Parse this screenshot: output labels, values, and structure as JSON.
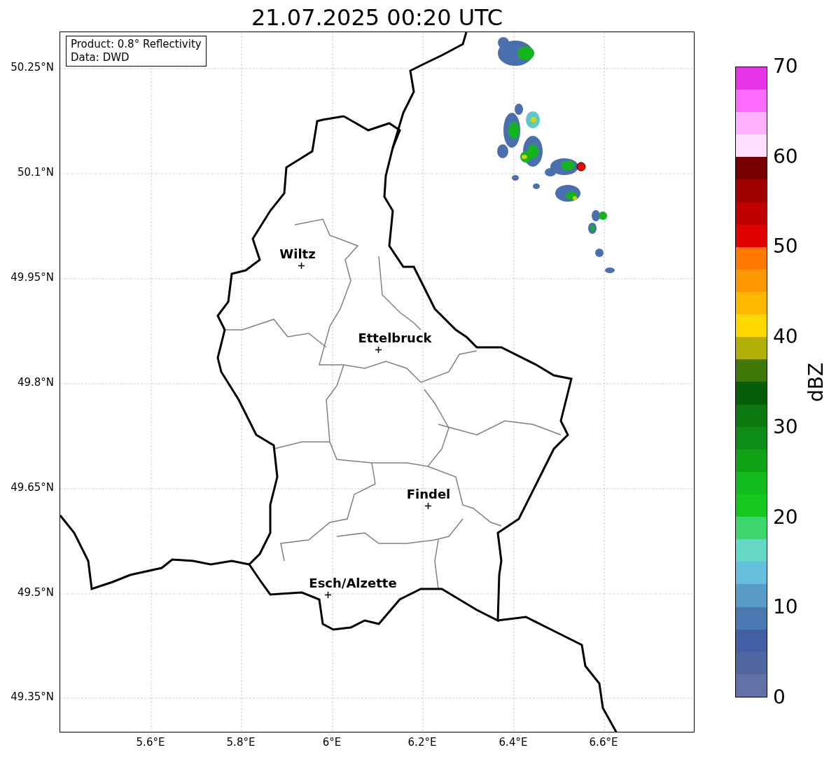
{
  "title": "21.07.2025 00:20 UTC",
  "info_box": [
    "Product: 0.8° Reflectivity",
    "Data: DWD"
  ],
  "lat_labels": [
    "50.25°N",
    "50.1°N",
    "49.95°N",
    "49.8°N",
    "49.65°N",
    "49.5°N",
    "49.35°N"
  ],
  "lon_labels": [
    "5.6°E",
    "5.8°E",
    "6°E",
    "6.2°E",
    "6.4°E",
    "6.6°E"
  ],
  "cities": [
    {
      "name": "Wiltz"
    },
    {
      "name": "Ettelbruck"
    },
    {
      "name": "Findel"
    },
    {
      "name": "Esch/Alzette"
    }
  ],
  "colorbar": {
    "label": "dBZ",
    "ticks": [
      "70",
      "60",
      "50",
      "40",
      "30",
      "20",
      "10",
      "0"
    ],
    "segments": [
      {
        "color": "#6272a6"
      },
      {
        "color": "#50669e"
      },
      {
        "color": "#435ea2"
      },
      {
        "color": "#4a78b2"
      },
      {
        "color": "#5a9cc8"
      },
      {
        "color": "#64c0dc"
      },
      {
        "color": "#64d8c4"
      },
      {
        "color": "#3cd66c"
      },
      {
        "color": "#14c81e"
      },
      {
        "color": "#12bc1c"
      },
      {
        "color": "#10a216"
      },
      {
        "color": "#0e8c18"
      },
      {
        "color": "#0c7810"
      },
      {
        "color": "#065e08"
      },
      {
        "color": "#407808"
      },
      {
        "color": "#b0b008"
      },
      {
        "color": "#ffd800"
      },
      {
        "color": "#ffb800"
      },
      {
        "color": "#ff9800"
      },
      {
        "color": "#ff7800"
      },
      {
        "color": "#e00000"
      },
      {
        "color": "#c00000"
      },
      {
        "color": "#a00000"
      },
      {
        "color": "#780000"
      },
      {
        "color": "#ffe0ff"
      },
      {
        "color": "#ffb0ff"
      },
      {
        "color": "#ff6cff"
      },
      {
        "color": "#e834e8"
      }
    ]
  }
}
